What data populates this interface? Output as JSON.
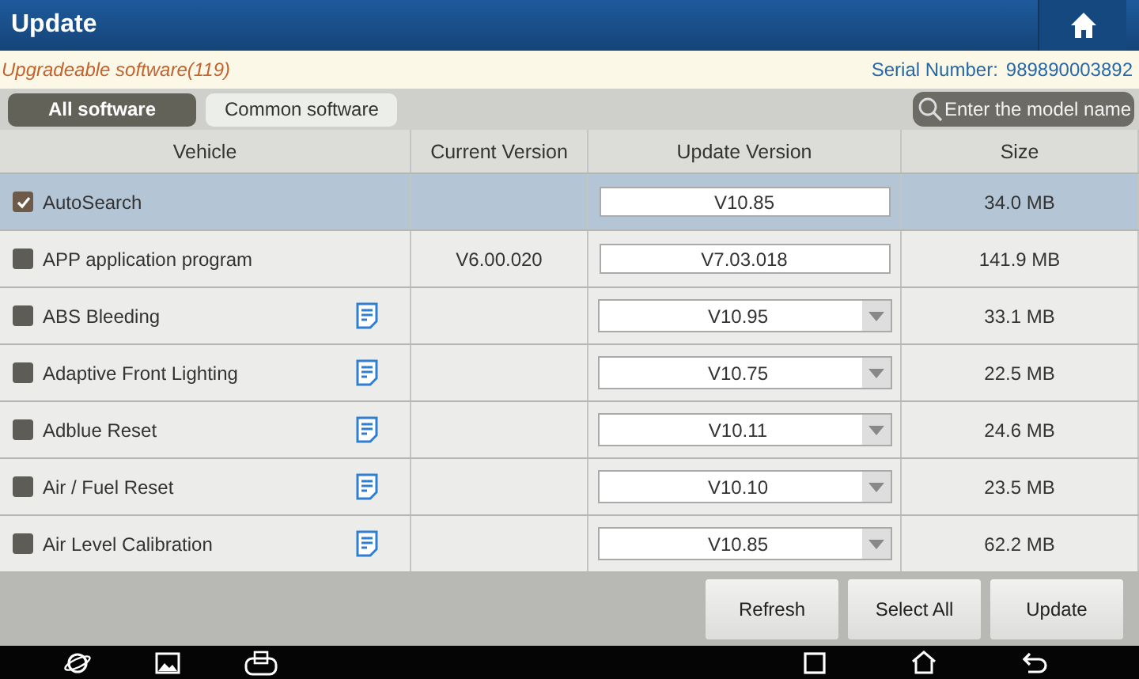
{
  "window": {
    "title": "Update"
  },
  "info": {
    "upgradeable": "Upgradeable software(119)",
    "serial_label": "Serial Number:",
    "serial": "989890003892"
  },
  "tabs": [
    {
      "label": "All software",
      "selected": true
    },
    {
      "label": "Common software",
      "selected": false
    }
  ],
  "search": {
    "placeholder": "Enter the model name"
  },
  "table": {
    "columns": [
      "Vehicle",
      "Current Version",
      "Update Version",
      "Size"
    ],
    "rows": [
      {
        "name": "AutoSearch",
        "checked": true,
        "selected": true,
        "notes": false,
        "current": "",
        "kind": "field",
        "update": "V10.85",
        "size": "34.0 MB"
      },
      {
        "name": "APP application program",
        "checked": false,
        "selected": false,
        "notes": false,
        "current": "V6.00.020",
        "kind": "field",
        "update": "V7.03.018",
        "size": "141.9 MB"
      },
      {
        "name": "ABS Bleeding",
        "checked": false,
        "selected": false,
        "notes": true,
        "current": "",
        "kind": "dropdown",
        "update": "V10.95",
        "size": "33.1 MB"
      },
      {
        "name": "Adaptive Front Lighting",
        "checked": false,
        "selected": false,
        "notes": true,
        "current": "",
        "kind": "dropdown",
        "update": "V10.75",
        "size": "22.5 MB"
      },
      {
        "name": "Adblue Reset",
        "checked": false,
        "selected": false,
        "notes": true,
        "current": "",
        "kind": "dropdown",
        "update": "V10.11",
        "size": "24.6 MB"
      },
      {
        "name": "Air / Fuel Reset",
        "checked": false,
        "selected": false,
        "notes": true,
        "current": "",
        "kind": "dropdown",
        "update": "V10.10",
        "size": "23.5 MB"
      },
      {
        "name": "Air Level Calibration",
        "checked": false,
        "selected": false,
        "notes": true,
        "current": "",
        "kind": "dropdown",
        "update": "V10.85",
        "size": "62.2 MB"
      }
    ]
  },
  "buttons": [
    "Refresh",
    "Select All",
    "Update"
  ]
}
